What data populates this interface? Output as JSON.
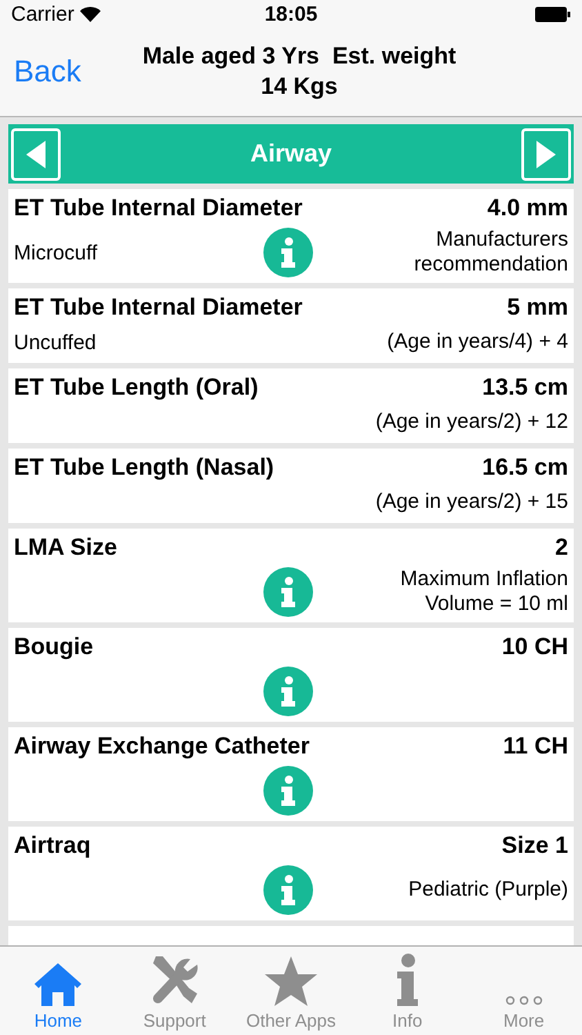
{
  "status_bar": {
    "carrier": "Carrier",
    "time": "18:05"
  },
  "nav": {
    "back": "Back",
    "title": "Male aged 3 Yrs  Est. weight\n14 Kgs"
  },
  "section": {
    "title": "Airway"
  },
  "rows": [
    {
      "name": "ET Tube Internal Diameter",
      "value": "4.0 mm",
      "detail": "Microcuff",
      "info": true,
      "note": "Manufacturers\nrecommendation"
    },
    {
      "name": "ET Tube Internal Diameter",
      "value": "5 mm",
      "detail": "Uncuffed",
      "info": false,
      "note": "(Age in years/4) + 4"
    },
    {
      "name": "ET Tube Length (Oral)",
      "value": "13.5 cm",
      "info": false,
      "note": "(Age in years/2) + 12"
    },
    {
      "name": "ET Tube Length (Nasal)",
      "value": "16.5 cm",
      "info": false,
      "note": "(Age in years/2) + 15"
    },
    {
      "name": "LMA Size",
      "value": "2",
      "info": true,
      "note": "Maximum Inflation\nVolume = 10 ml"
    },
    {
      "name": "Bougie",
      "value": "10 CH",
      "info": true
    },
    {
      "name": "Airway Exchange Catheter",
      "value": "11 CH",
      "info": true
    },
    {
      "name": "Airtraq",
      "value": "Size 1",
      "info": true,
      "note": "Pediatric (Purple)"
    }
  ],
  "tabs": [
    {
      "label": "Home",
      "kind": "home",
      "selected": true
    },
    {
      "label": "Support",
      "kind": "tools",
      "selected": false
    },
    {
      "label": "Other Apps",
      "kind": "star",
      "selected": false
    },
    {
      "label": "Info",
      "kind": "info",
      "selected": false
    },
    {
      "label": "More",
      "kind": "more",
      "selected": false
    }
  ]
}
